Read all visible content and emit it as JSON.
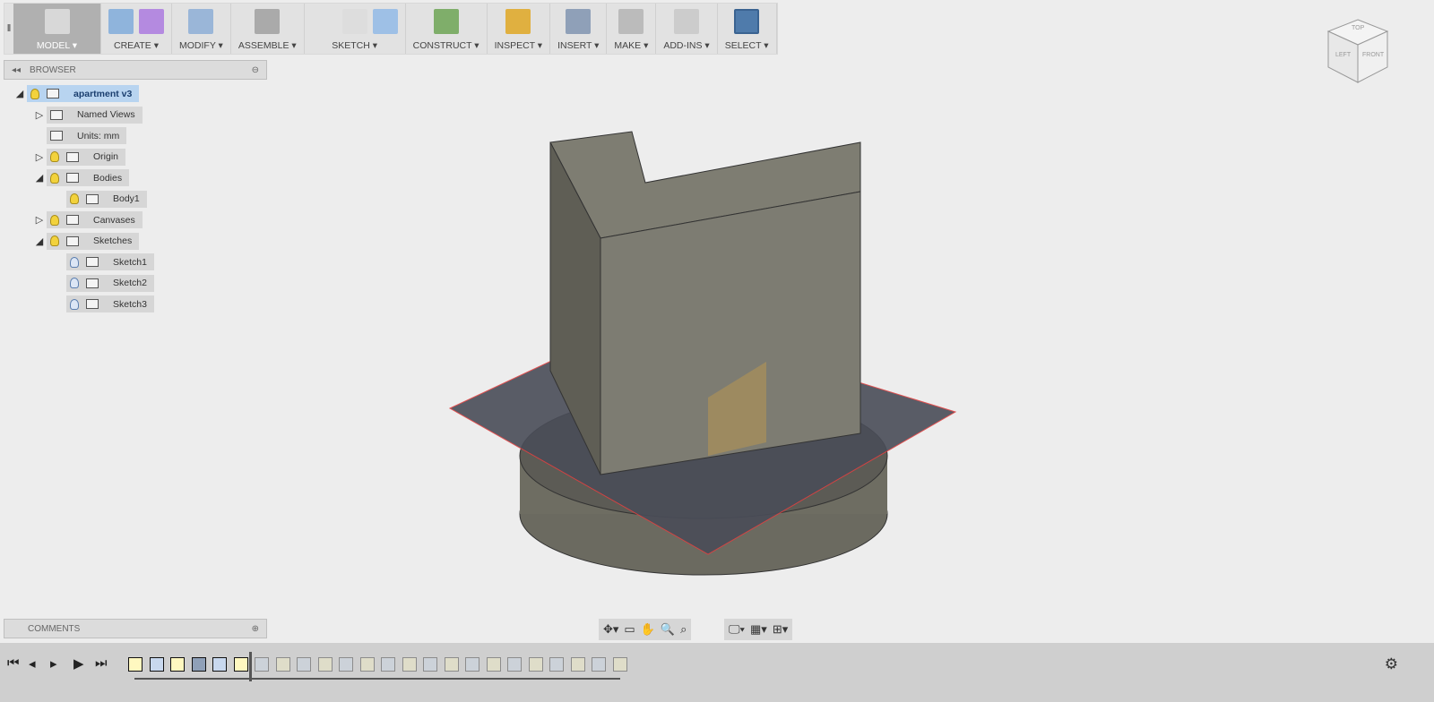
{
  "toolbar": {
    "groups": [
      {
        "label": "MODEL ▾",
        "icons": [
          "model-workspace-icon"
        ]
      },
      {
        "label": "CREATE ▾",
        "icons": [
          "box-icon",
          "form-icon"
        ]
      },
      {
        "label": "MODIFY ▾",
        "icons": [
          "press-pull-icon"
        ]
      },
      {
        "label": "ASSEMBLE ▾",
        "icons": [
          "joint-icon"
        ]
      },
      {
        "label": "SKETCH ▾",
        "icons": [
          "arc-icon",
          "rectangle-icon",
          "project-icon"
        ]
      },
      {
        "label": "CONSTRUCT ▾",
        "icons": [
          "plane-icon"
        ]
      },
      {
        "label": "INSPECT ▾",
        "icons": [
          "measure-icon"
        ]
      },
      {
        "label": "INSERT ▾",
        "icons": [
          "canvas-image-icon"
        ]
      },
      {
        "label": "MAKE ▾",
        "icons": [
          "3d-print-icon"
        ]
      },
      {
        "label": "ADD-INS ▾",
        "icons": [
          "scripts-icon"
        ]
      },
      {
        "label": "SELECT ▾",
        "icons": [
          "select-icon"
        ]
      }
    ]
  },
  "browser": {
    "title": "BROWSER",
    "items": [
      {
        "label": "apartment v3",
        "expand": "◢",
        "bulb": "on",
        "icon": "component"
      },
      {
        "label": "Named Views",
        "expand": "▷",
        "icon": "folder"
      },
      {
        "label": "Units: mm",
        "icon": "doc"
      },
      {
        "label": "Origin",
        "expand": "▷",
        "bulb": "on",
        "icon": "folder"
      },
      {
        "label": "Bodies",
        "expand": "◢",
        "bulb": "on",
        "icon": "folder"
      },
      {
        "label": "Body1",
        "bulb": "on",
        "icon": "body"
      },
      {
        "label": "Canvases",
        "expand": "▷",
        "bulb": "on",
        "icon": "folder"
      },
      {
        "label": "Sketches",
        "expand": "◢",
        "bulb": "on",
        "icon": "folder"
      },
      {
        "label": "Sketch1",
        "bulb": "off",
        "icon": "sketch"
      },
      {
        "label": "Sketch2",
        "bulb": "off",
        "icon": "sketch"
      },
      {
        "label": "Sketch3",
        "bulb": "off",
        "icon": "sketch"
      }
    ]
  },
  "comments": {
    "title": "COMMENTS"
  },
  "viewcube": {
    "top": "TOP",
    "left": "LEFT",
    "front": "FRONT"
  },
  "timeline": {
    "controls": [
      "⏮",
      "◂",
      "▸",
      "▶",
      "⏭"
    ],
    "active": [
      "sketch",
      "extrude",
      "sketch",
      "canvas",
      "extrude",
      "sketch"
    ],
    "inactive_count": 18
  }
}
